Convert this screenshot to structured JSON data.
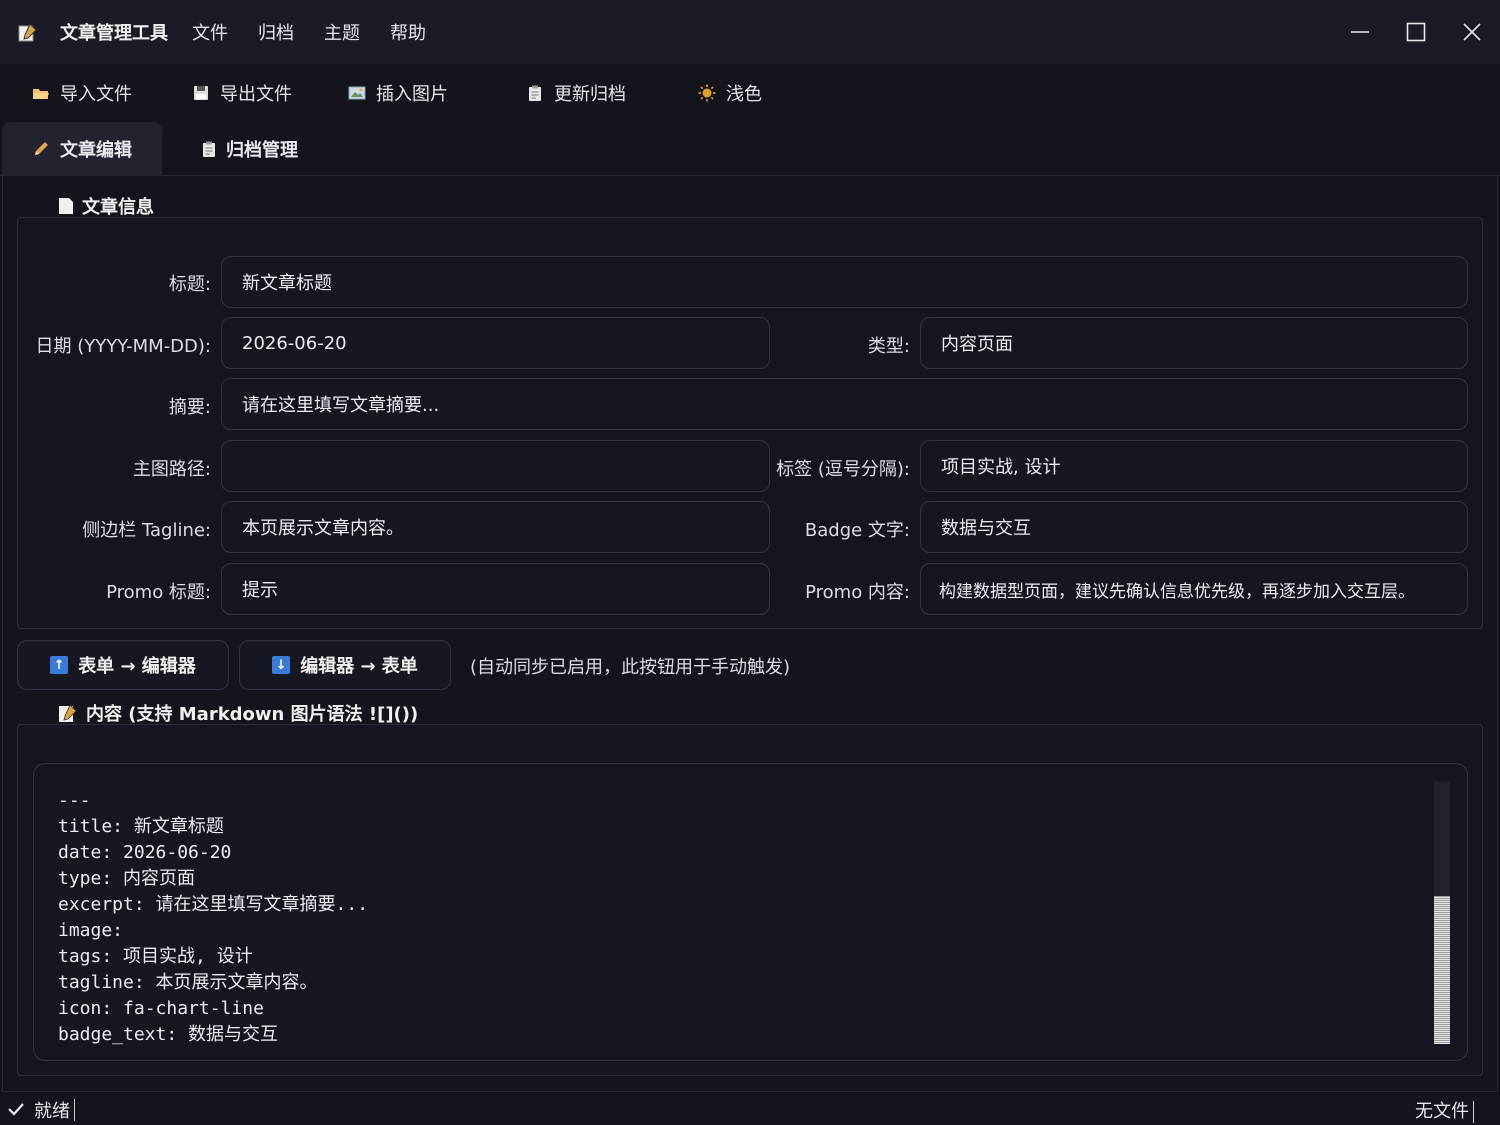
{
  "app": {
    "title": "文章管理工具",
    "icon": "notepad-icon"
  },
  "menu": [
    "文件",
    "归档",
    "主题",
    "帮助"
  ],
  "toolbar": {
    "import_label": "导入文件",
    "export_label": "导出文件",
    "insert_image_label": "插入图片",
    "update_archive_label": "更新归档",
    "theme_label": "浅色"
  },
  "tabs": {
    "editor_label": "文章编辑",
    "archive_label": "归档管理"
  },
  "info_section": {
    "title": "文章信息",
    "fields": {
      "title_label": "标题:",
      "title_value": "新文章标题",
      "date_label": "日期 (YYYY-MM-DD):",
      "date_value": "2026-06-20",
      "type_label": "类型:",
      "type_value": "内容页面",
      "excerpt_label": "摘要:",
      "excerpt_value": "请在这里填写文章摘要...",
      "image_label": "主图路径:",
      "image_value": "",
      "tags_label": "标签 (逗号分隔):",
      "tags_value": "项目实战, 设计",
      "tagline_label": "侧边栏 Tagline:",
      "tagline_value": "本页展示文章内容。",
      "badge_label": "Badge 文字:",
      "badge_value": "数据与交互",
      "promo_title_label": "Promo 标题:",
      "promo_title_value": "提示",
      "promo_content_label": "Promo 内容:",
      "promo_content_value": "构建数据型页面，建议先确认信息优先级，再逐步加入交互层。"
    }
  },
  "sync": {
    "form_to_editor_label": "表单 → 编辑器",
    "editor_to_form_label": "编辑器 → 表单",
    "note": "(自动同步已启用，此按钮用于手动触发)"
  },
  "content_section": {
    "title": "内容 (支持 Markdown 图片语法 ![]())",
    "lines": [
      "---",
      "title: 新文章标题",
      "date: 2026-06-20",
      "type: 内容页面",
      "excerpt: 请在这里填写文章摘要...",
      "image:",
      "tags: 项目实战, 设计",
      "tagline: 本页展示文章内容。",
      "icon: fa-chart-line",
      "badge_text: 数据与交互"
    ]
  },
  "status": {
    "left": "就绪",
    "right": "无文件"
  }
}
